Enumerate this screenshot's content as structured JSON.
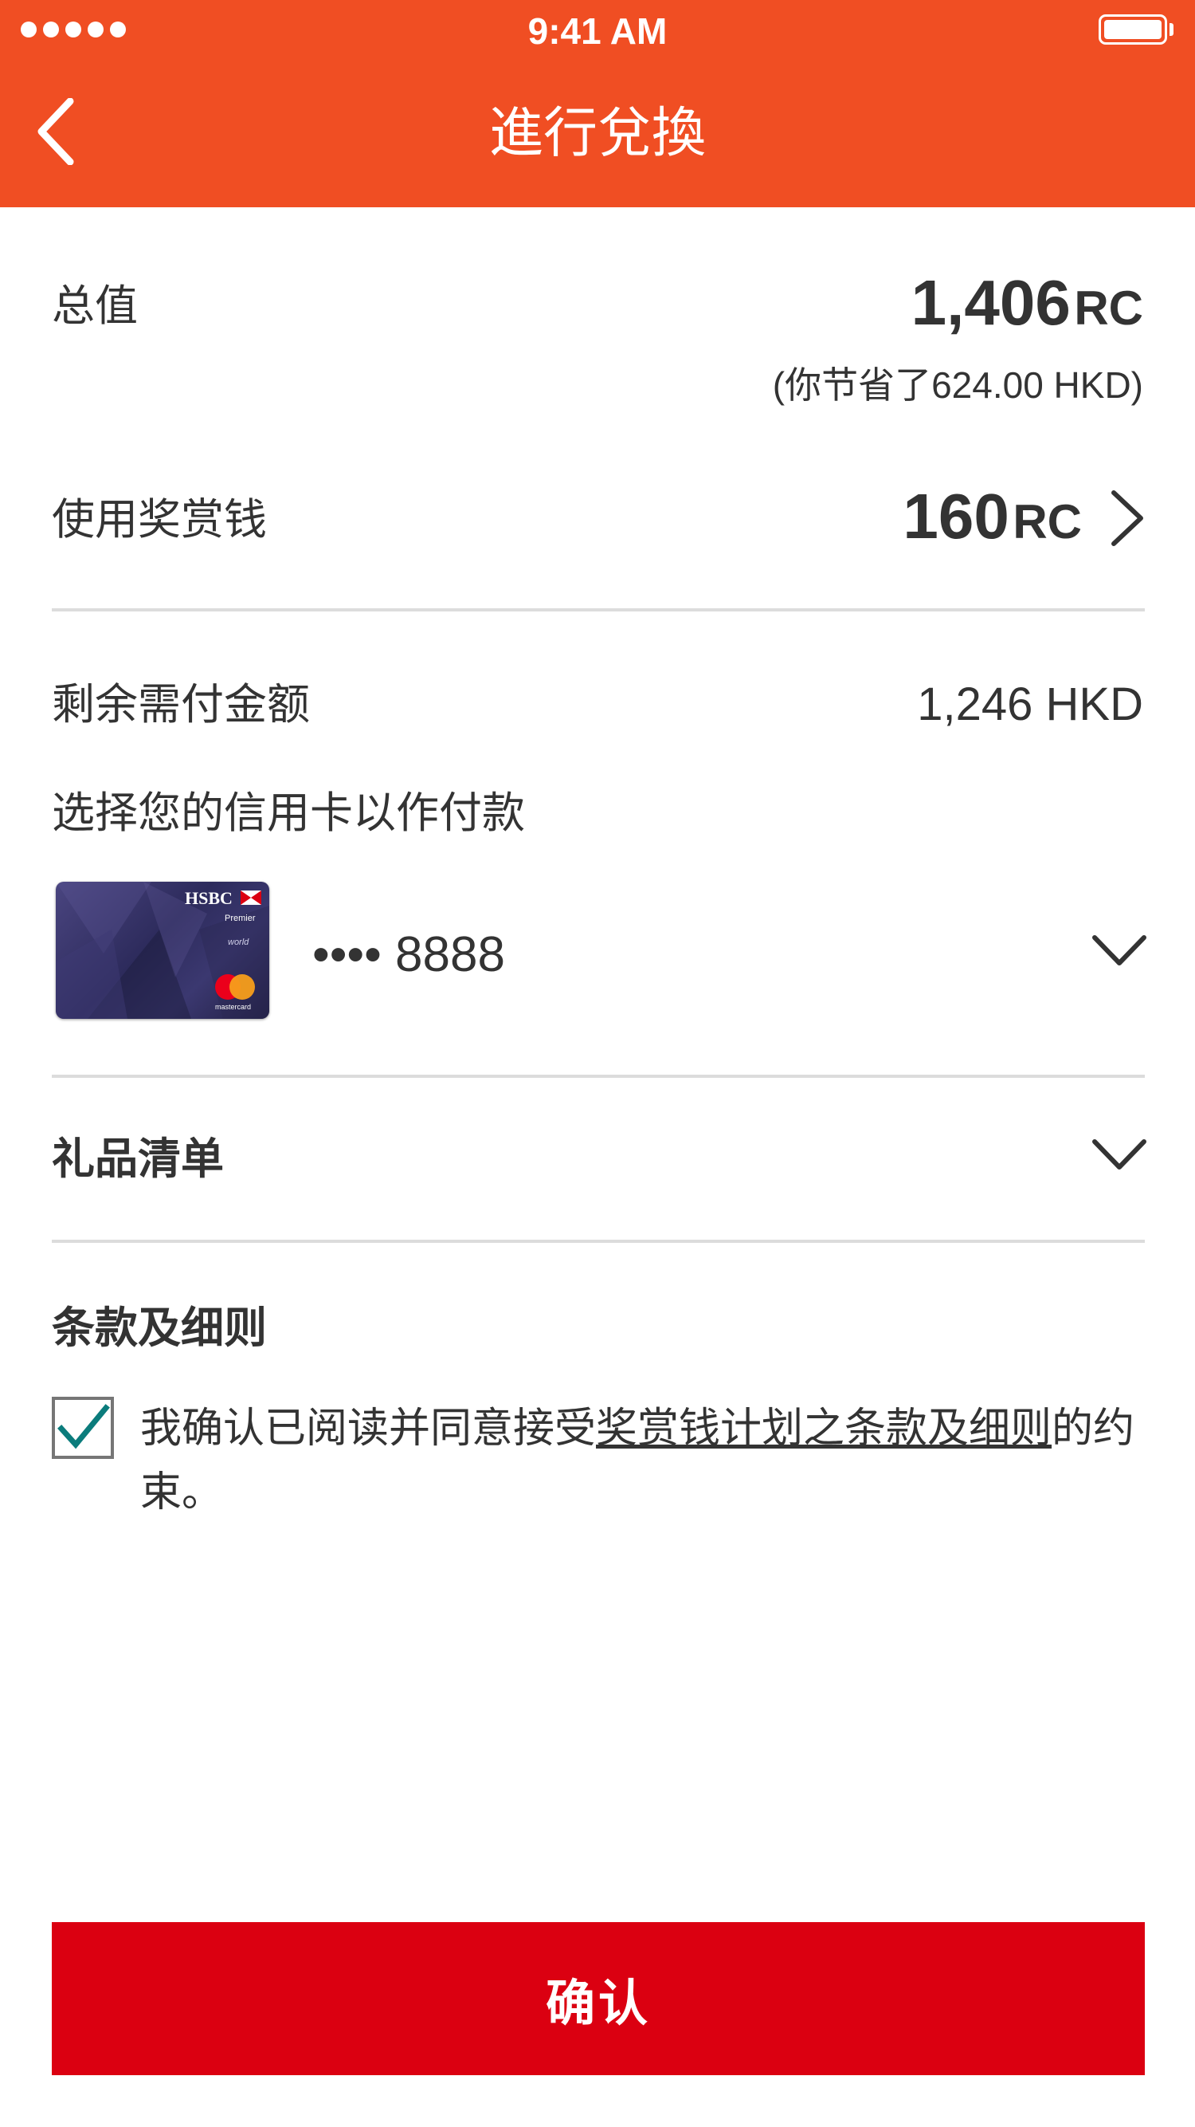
{
  "status_bar": {
    "time": "9:41 AM",
    "signal_icon": "signal-dots-icon",
    "battery_icon": "battery-icon"
  },
  "header": {
    "title": "進行兌換",
    "back_icon": "chevron-left-icon",
    "background_color": "#f04e23"
  },
  "total": {
    "label": "总值",
    "value": "1,406",
    "unit": "RC",
    "savings_note": "(你节省了624.00 HKD)"
  },
  "reward_cash": {
    "label": "使用奖赏钱",
    "value": "160",
    "unit": "RC",
    "icon": "chevron-right-icon"
  },
  "remaining": {
    "label": "剩余需付金额",
    "value": "1,246 HKD"
  },
  "payment": {
    "prompt": "选择您的信用卡以作付款",
    "card_masked": "•••• 8888",
    "card_brand": "HSBC",
    "card_tier": "Premier",
    "card_variant": "world",
    "card_network": "mastercard",
    "dropdown_icon": "chevron-down-icon"
  },
  "gift_list": {
    "label": "礼品清单",
    "dropdown_icon": "chevron-down-icon"
  },
  "terms": {
    "title": "条款及细则",
    "checked": true,
    "text_before": "我确认已阅读并同意接受",
    "link_text": "奖赏钱计划之条款及细则",
    "text_after": "的约束。",
    "check_color": "#0b7c7c"
  },
  "confirm_button": {
    "label": "确认",
    "color": "#db0011"
  }
}
